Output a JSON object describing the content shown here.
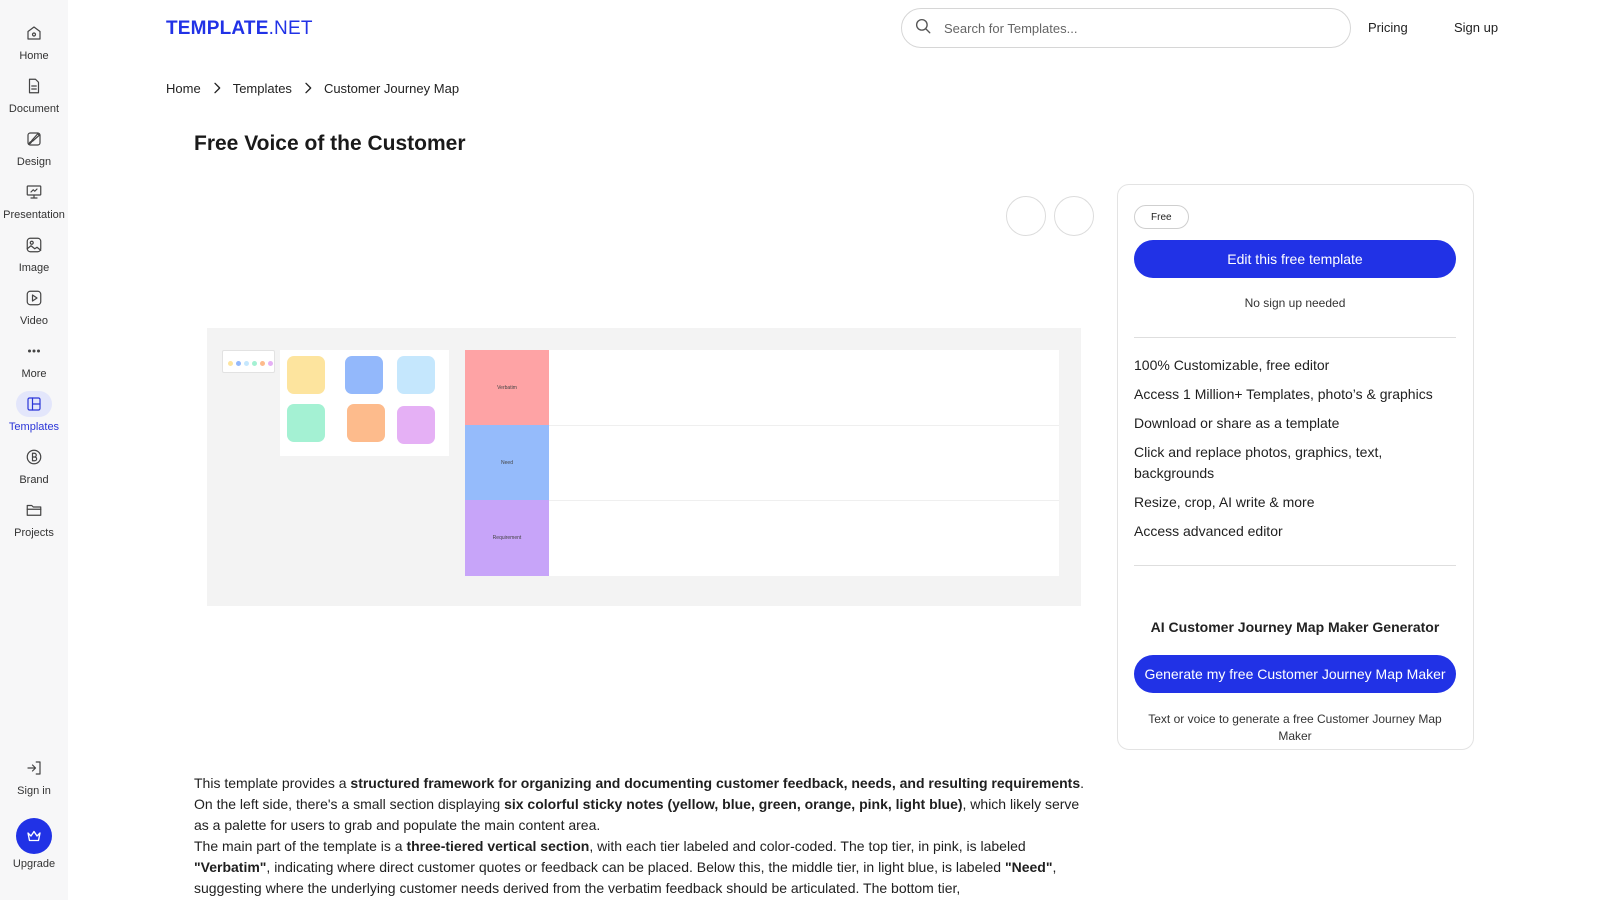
{
  "sidebar": {
    "items": [
      {
        "label": "Home",
        "icon": "home-icon"
      },
      {
        "label": "Document",
        "icon": "document-icon"
      },
      {
        "label": "Design",
        "icon": "design-icon"
      },
      {
        "label": "Presentation",
        "icon": "presentation-icon"
      },
      {
        "label": "Image",
        "icon": "image-icon"
      },
      {
        "label": "Video",
        "icon": "video-icon"
      },
      {
        "label": "More",
        "icon": "more-icon"
      },
      {
        "label": "Templates",
        "icon": "templates-icon",
        "active": true
      },
      {
        "label": "Brand",
        "icon": "brand-icon"
      },
      {
        "label": "Projects",
        "icon": "folder-icon"
      }
    ],
    "sign_in": "Sign in",
    "upgrade": "Upgrade"
  },
  "header": {
    "logo_bold": "TEMPLATE",
    "logo_rest": ".NET",
    "search_placeholder": "Search for Templates...",
    "pricing": "Pricing",
    "sign_up": "Sign up"
  },
  "breadcrumb": [
    "Home",
    "Templates",
    "Customer Journey Map"
  ],
  "page_title": "Free Voice of the Customer",
  "preview": {
    "sticky_colors": [
      "#fde49e",
      "#93b8fb",
      "#c5e7fd",
      "#a4f1d3",
      "#fdbb8c",
      "#e5b0f5"
    ],
    "tiers": [
      {
        "label": "Verbatim",
        "color": "#fea3a5"
      },
      {
        "label": "Need",
        "color": "#95bbfb"
      },
      {
        "label": "Requirement",
        "color": "#c7a4f9"
      }
    ]
  },
  "card": {
    "badge": "Free",
    "edit_button": "Edit this free template",
    "no_signup": "No sign up needed",
    "features": [
      "100% Customizable, free editor",
      "Access 1 Million+ Templates, photo’s & graphics",
      "Download or share as a template",
      "Click and replace photos, graphics, text, backgrounds",
      "Resize, crop, AI write & more",
      "Access advanced editor"
    ],
    "generator_title": "AI Customer Journey Map Maker Generator",
    "generate_button": "Generate my free Customer Journey Map Maker",
    "generate_note": "Text or voice to generate a free Customer Journey Map Maker"
  },
  "description": {
    "p1": {
      "t1": "This template provides a ",
      "b1": "structured framework for organizing and documenting customer feedback, needs, and resulting requirements",
      "t2": ". On the left side, there's a small section displaying ",
      "b2": "six colorful sticky notes (yellow, blue, green, orange, pink, light blue)",
      "t3": ", which likely serve as a palette for users to grab and populate the main content area."
    },
    "p2": {
      "t1": "The main part of the template is a ",
      "b1": "three-tiered vertical section",
      "t2": ", with each tier labeled and color-coded. The top tier, in pink, is labeled ",
      "b2": "\"Verbatim\"",
      "t3": ", indicating where direct customer quotes or feedback can be placed. Below this, the middle tier, in light blue, is labeled ",
      "b3": "\"Need\"",
      "t4": ", suggesting where the underlying customer needs derived from the verbatim feedback should be articulated. The bottom tier,"
    }
  }
}
